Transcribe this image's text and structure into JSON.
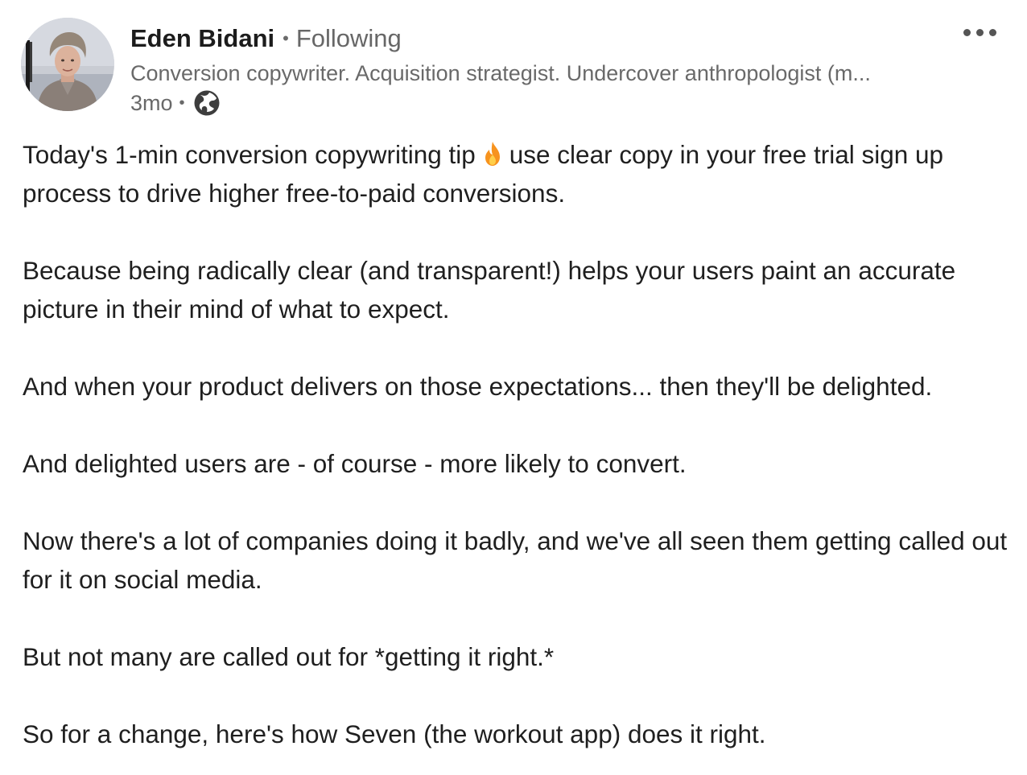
{
  "post": {
    "author": {
      "name": "Eden Bidani",
      "separator": "•",
      "follow_status": "Following",
      "headline": "Conversion copywriter. Acquisition strategist. Undercover anthropologist (m...",
      "time": "3mo",
      "time_separator": "•",
      "visibility_icon": "globe-icon",
      "avatar_icon": "avatar-photo"
    },
    "menu_icon": "more-options-icon",
    "paragraphs": {
      "p1_before": "Today's 1-min conversion copywriting tip",
      "p1_emoji": "fire-emoji-icon",
      "p1_after": "use clear copy in your free trial sign up process to drive higher free-to-paid conversions.",
      "p2": "Because being radically clear (and transparent!) helps your users paint an accurate picture in their mind of what to expect.",
      "p3": "And when your product delivers on those expectations... then they'll be delighted.",
      "p4": "And delighted users are - of course - more likely to convert.",
      "p5": "Now there's a lot of companies doing it badly, and we've all seen them getting called out for it on social media.",
      "p6": "But not many are called out for *getting it right.*",
      "p7": "So for a change, here's how Seven (the workout app) does it right."
    }
  }
}
